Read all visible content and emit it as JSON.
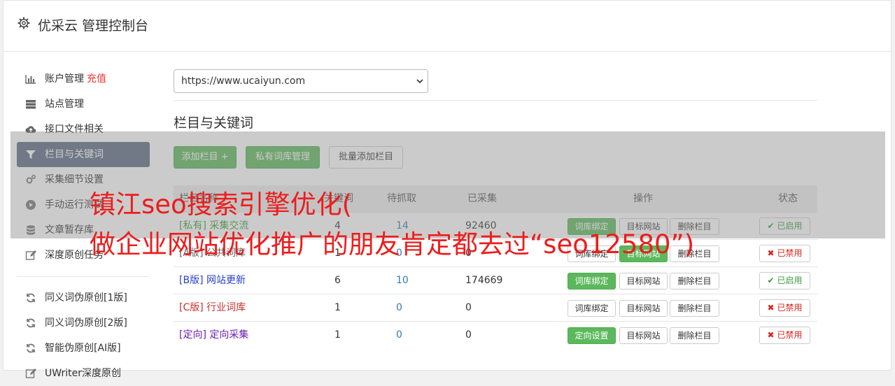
{
  "header": {
    "title": "优采云 管理控制台",
    "icon": "gear-icon"
  },
  "sidebar": {
    "items": [
      {
        "label": "账户管理",
        "extra": "充值",
        "icon": "bar-chart-icon",
        "active": false
      },
      {
        "label": "站点管理",
        "icon": "server-icon",
        "active": false
      },
      {
        "label": "接口文件相关",
        "icon": "cloud-upload-icon",
        "active": false
      },
      {
        "label": "栏目与关键词",
        "icon": "filter-icon",
        "active": true
      },
      {
        "label": "采集细节设置",
        "icon": "cogs-icon",
        "active": false
      },
      {
        "label": "手动运行测试",
        "icon": "play-icon",
        "active": false
      },
      {
        "label": "文章暂存库",
        "icon": "database-icon",
        "active": false
      },
      {
        "label": "深度原创任务",
        "icon": "edit-icon",
        "active": false
      }
    ],
    "items2": [
      {
        "label": "同义词伪原创[1版]",
        "icon": "refresh-icon"
      },
      {
        "label": "同义词伪原创[2版]",
        "icon": "refresh-icon"
      },
      {
        "label": "智能伪原创[AI版]",
        "icon": "refresh-icon"
      },
      {
        "label": "UWriter深度原创",
        "icon": "edit-icon"
      }
    ]
  },
  "site_select": {
    "value": "https://www.ucaiyun.com"
  },
  "section_title": "栏目与关键词",
  "toolbar": {
    "add_column": "添加栏目 +",
    "private_lib": "私有词库管理",
    "batch_add": "批量添加栏目"
  },
  "table": {
    "headers": [
      "栏目名称",
      "关键词",
      "待抓取",
      "已采集",
      "操作",
      "状态"
    ],
    "rows": [
      {
        "category": "[私有] 采集交流",
        "color": "green",
        "kw": "4",
        "pending": "14",
        "collected": "92460",
        "bind_label": "词库绑定",
        "bind_green": true,
        "site_label": "目标网站",
        "site_green": false,
        "delete_label": "删除栏目",
        "status": "已启用",
        "status_on": true
      },
      {
        "category": "[A版] 公共词库",
        "color": "gray",
        "kw": "1",
        "pending": "0",
        "collected": "0",
        "bind_label": "词库绑定",
        "bind_green": false,
        "site_label": "目标网站",
        "site_green": true,
        "delete_label": "删除栏目",
        "status": "已禁用",
        "status_on": false
      },
      {
        "category": "[B版] 网站更新",
        "color": "blue",
        "kw": "6",
        "pending": "10",
        "collected": "174669",
        "bind_label": "词库绑定",
        "bind_green": true,
        "site_label": "目标网站",
        "site_green": false,
        "delete_label": "删除栏目",
        "status": "已启用",
        "status_on": true
      },
      {
        "category": "[C版] 行业词库",
        "color": "red",
        "kw": "1",
        "pending": "0",
        "collected": "0",
        "bind_label": "词库绑定",
        "bind_green": false,
        "site_label": "目标网站",
        "site_green": false,
        "delete_label": "删除栏目",
        "status": "已禁用",
        "status_on": false
      },
      {
        "category": "[定向] 定向采集",
        "color": "purple",
        "kw": "1",
        "pending": "0",
        "collected": "0",
        "bind_label": "定向设置",
        "bind_green": true,
        "site_label": "目标网站",
        "site_green": false,
        "delete_label": "删除栏目",
        "status": "已禁用",
        "status_on": false
      }
    ]
  },
  "watermark": {
    "line1": "镇江seo搜索引擎优化(",
    "line2": "做企业网站优化推广的朋友肯定都去过“seo12580”)"
  },
  "colors": {
    "accent_green": "#5cb85c",
    "active_nav": "#5b6b84",
    "watermark": "#ee1c1c"
  }
}
